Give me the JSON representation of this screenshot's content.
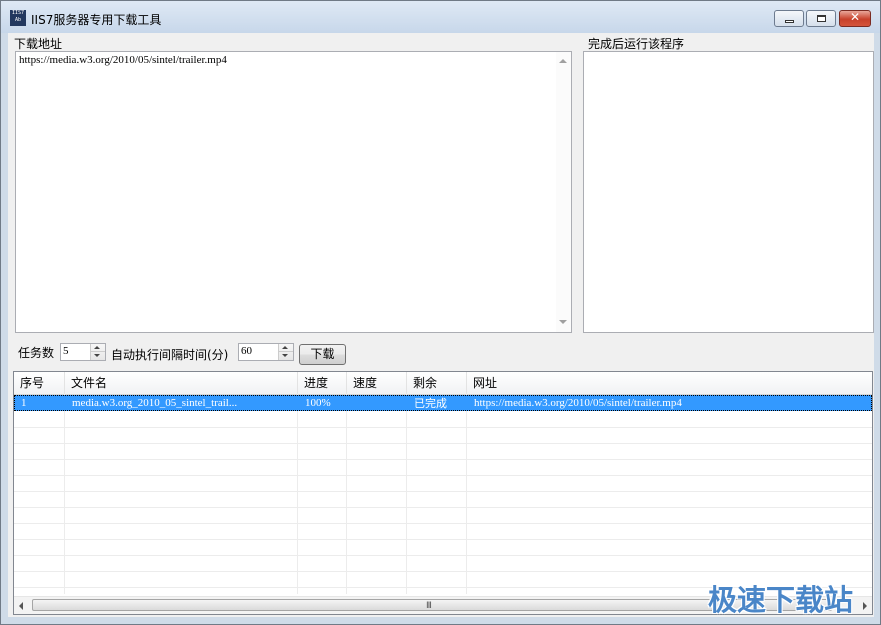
{
  "window": {
    "title": "IIS7服务器专用下载工具",
    "app_icon_text": "IIS7 Ab"
  },
  "download_section": {
    "label": "下载地址",
    "url_text": "https://media.w3.org/2010/05/sintel/trailer.mp4"
  },
  "run_section": {
    "label": "完成后运行该程序",
    "value": ""
  },
  "controls": {
    "task_count_label": "任务数",
    "task_count_value": "5",
    "interval_label": "自动执行间隔时间(分)",
    "interval_value": "60",
    "download_button": "下载"
  },
  "table": {
    "columns": [
      "序号",
      "文件名",
      "进度",
      "速度",
      "剩余",
      "网址"
    ],
    "rows": [
      [
        "1",
        "media.w3.org_2010_05_sintel_trail...",
        "100%",
        "",
        "已完成",
        "https://media.w3.org/2010/05/sintel/trailer.mp4"
      ]
    ],
    "scroll_grip": "III"
  },
  "watermark": "极速下载站",
  "colors": {
    "selection": "#3399ff",
    "watermark": "#4a86c8",
    "close_button": "#c8412b"
  }
}
